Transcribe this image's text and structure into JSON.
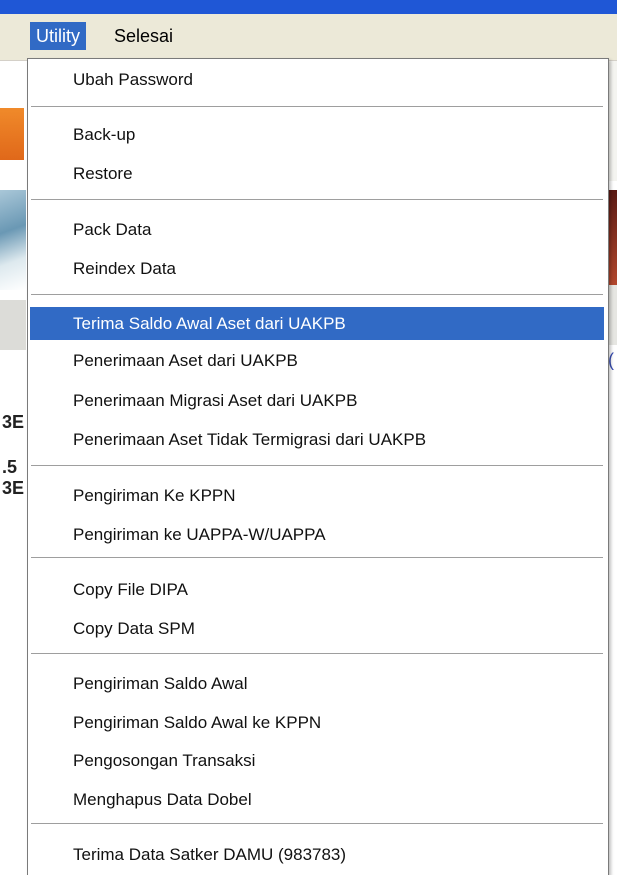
{
  "menubar": {
    "items": [
      {
        "label": "Utility",
        "active": true
      },
      {
        "label": "Selesai",
        "active": false
      }
    ]
  },
  "background": {
    "left_texts": [
      "3E",
      ".5",
      "3E"
    ],
    "right_partial": "("
  },
  "dropdown": {
    "groups": [
      {
        "items": [
          {
            "label": "Ubah Password"
          }
        ]
      },
      {
        "items": [
          {
            "label": "Back-up"
          },
          {
            "label": "Restore"
          }
        ]
      },
      {
        "items": [
          {
            "label": "Pack Data"
          },
          {
            "label": "Reindex Data"
          }
        ]
      },
      {
        "items": [
          {
            "label": "Terima Saldo Awal Aset dari UAKPB",
            "highlighted": true
          },
          {
            "label": "Penerimaan Aset dari UAKPB"
          },
          {
            "label": "Penerimaan Migrasi Aset dari UAKPB"
          },
          {
            "label": "Penerimaan Aset Tidak Termigrasi dari UAKPB"
          }
        ]
      },
      {
        "items": [
          {
            "label": "Pengiriman Ke KPPN"
          },
          {
            "label": "Pengiriman ke UAPPA-W/UAPPA"
          }
        ]
      },
      {
        "items": [
          {
            "label": "Copy File DIPA"
          },
          {
            "label": "Copy Data SPM"
          }
        ]
      },
      {
        "items": [
          {
            "label": "Pengiriman Saldo Awal"
          },
          {
            "label": "Pengiriman Saldo Awal ke KPPN"
          },
          {
            "label": "Pengosongan Transaksi"
          },
          {
            "label": "Menghapus Data Dobel"
          }
        ]
      },
      {
        "items": [
          {
            "label": "Terima Data Satker DAMU (983783)"
          }
        ]
      }
    ]
  },
  "colors": {
    "highlight": "#316ac5",
    "titlebar": "#1f57d6",
    "menubar": "#ece9d8"
  }
}
